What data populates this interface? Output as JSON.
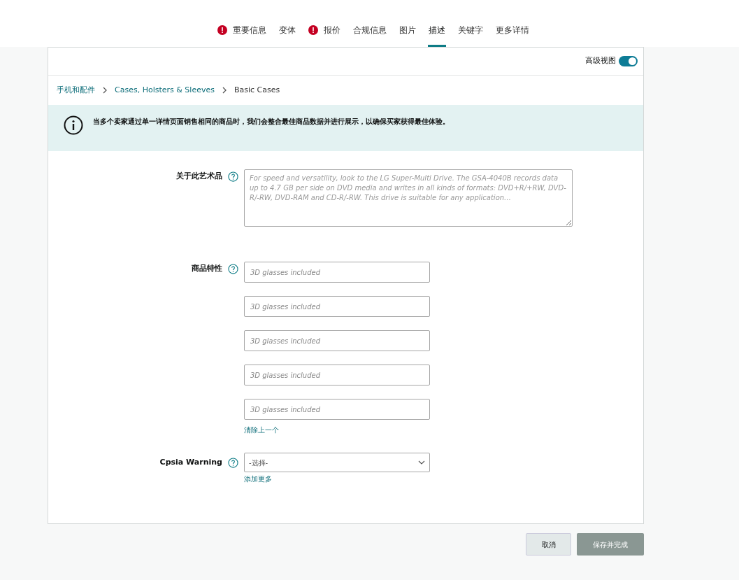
{
  "tabs": [
    {
      "label": "重要信息",
      "warning": true,
      "selected": false
    },
    {
      "label": "变体",
      "warning": false,
      "selected": false
    },
    {
      "label": "报价",
      "warning": true,
      "selected": false
    },
    {
      "label": "合规信息",
      "warning": false,
      "selected": false
    },
    {
      "label": "图片",
      "warning": false,
      "selected": false
    },
    {
      "label": "描述",
      "warning": false,
      "selected": true
    },
    {
      "label": "关键字",
      "warning": false,
      "selected": false
    },
    {
      "label": "更多详情",
      "warning": false,
      "selected": false
    }
  ],
  "advanced_view": {
    "label": "高级视图",
    "on": true
  },
  "breadcrumb": [
    {
      "label": "手机和配件",
      "link": true
    },
    {
      "label": "Cases, Holsters & Sleeves",
      "link": true
    },
    {
      "label": "Basic Cases",
      "link": false
    }
  ],
  "notice": "当多个卖家通过单一详情页面销售相同的商品时，我们会整合最佳商品数据并进行展示，以确保买家获得最佳体验。",
  "about": {
    "label": "关于此艺术品",
    "placeholder": "For speed and versatility, look to the LG Super-Multi Drive. The GSA-4040B records data up to 4.7 GB per side on DVD media and writes in all kinds of formats: DVD+R/+RW, DVD-R/-RW, DVD-RAM and CD-R/-RW. This drive is suitable for any application…"
  },
  "features": {
    "label": "商品特性",
    "fields": [
      {
        "placeholder": "3D glasses included"
      },
      {
        "placeholder": "3D glasses included"
      },
      {
        "placeholder": "3D glasses included"
      },
      {
        "placeholder": "3D glasses included"
      },
      {
        "placeholder": "3D glasses included"
      }
    ],
    "remove_link": "清除上一个"
  },
  "cpsia": {
    "label": "Cpsia Warning",
    "value": "-选择-",
    "add_link": "添加更多"
  },
  "buttons": {
    "cancel": {
      "label": "取消",
      "disabled": false
    },
    "save": {
      "label": "保存并完成",
      "disabled": true
    }
  }
}
